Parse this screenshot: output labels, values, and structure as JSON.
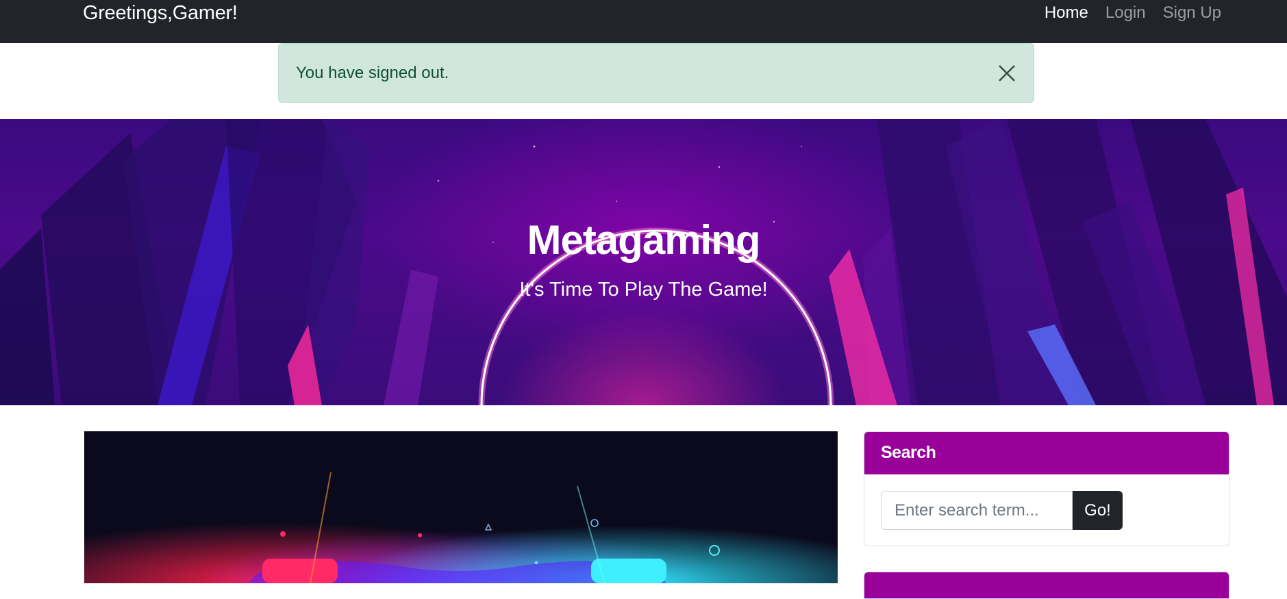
{
  "navbar": {
    "brand": "Greetings,Gamer!",
    "links": [
      {
        "label": "Home",
        "active": true
      },
      {
        "label": "Login",
        "active": false
      },
      {
        "label": "Sign Up",
        "active": false
      }
    ]
  },
  "alert": {
    "message": "You have signed out.",
    "close_icon": "close-icon",
    "color": "#d1e7dd"
  },
  "hero": {
    "title": "Metagaming",
    "subtitle": "It's Time To Play The Game!"
  },
  "sidebar": {
    "search": {
      "header": "Search",
      "placeholder": "Enter search term...",
      "button_label": "Go!"
    },
    "accent_color": "#990099"
  },
  "colors": {
    "navbar": "#212529",
    "card_header": "#990099",
    "button": "#212529"
  }
}
